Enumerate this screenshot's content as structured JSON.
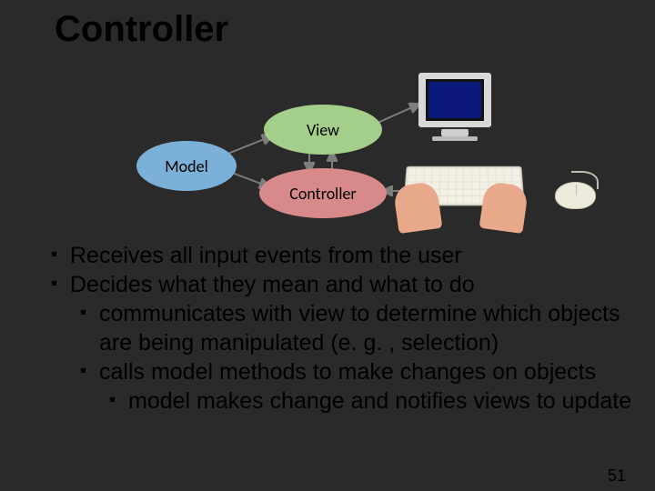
{
  "title": "Controller",
  "diagram": {
    "model": {
      "label": "Model"
    },
    "view": {
      "label": "View"
    },
    "controller": {
      "label": "Controller"
    },
    "devices": {
      "monitor": "monitor-icon",
      "keyboard": "keyboard-icon",
      "mouse": "mouse-icon",
      "hands": "hands-icon"
    }
  },
  "bullets": {
    "b1": "Receives all input events from the user",
    "b2": "Decides what they mean and what to do",
    "b2a": "communicates with view to determine which objects are being manipulated (e. g. , selection)",
    "b2b": "calls model methods to make changes on objects",
    "b2b1": "model makes change and notifies views to update"
  },
  "page_number": "51"
}
